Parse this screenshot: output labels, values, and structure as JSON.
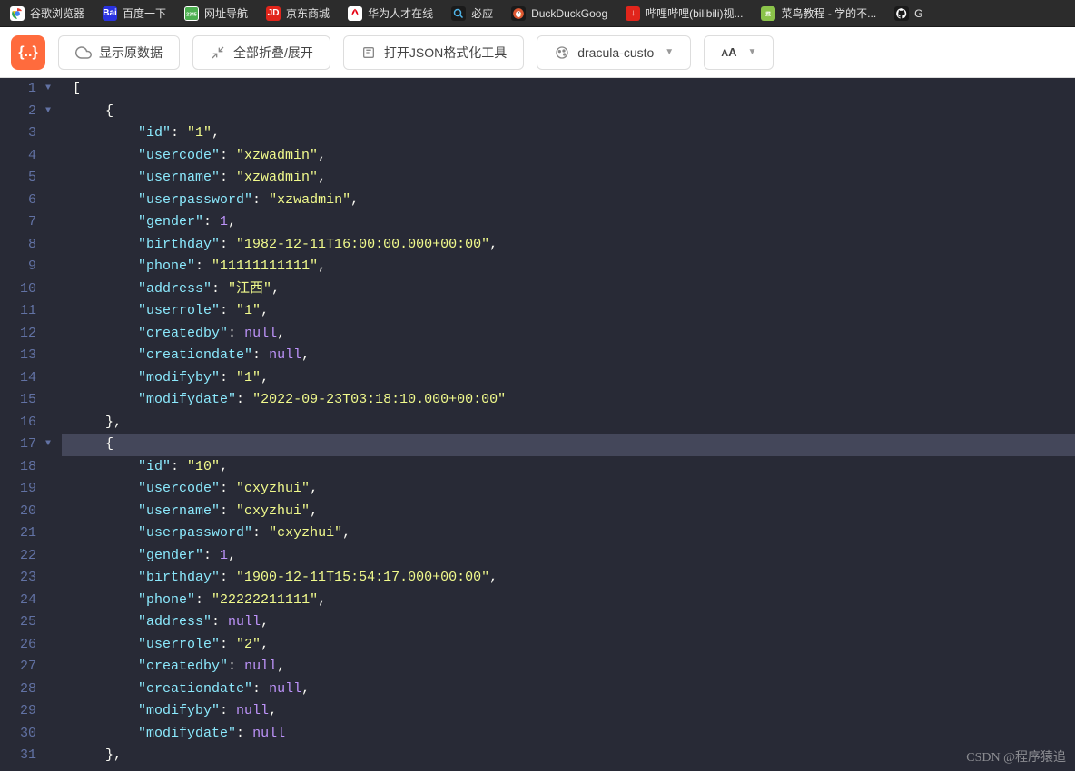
{
  "bookmarks": [
    {
      "icon_bg": "#fff",
      "icon_text": "",
      "label": "谷歌浏览器",
      "icon_svg": "chrome"
    },
    {
      "icon_bg": "#2932e1",
      "icon_text": "Bai",
      "label": "百度一下"
    },
    {
      "icon_bg": "#fff",
      "icon_text": "",
      "label": "网址导航",
      "icon_svg": "hao"
    },
    {
      "icon_bg": "#e1251b",
      "icon_text": "JD",
      "label": "京东商城"
    },
    {
      "icon_bg": "#fff",
      "icon_text": "",
      "label": "华为人才在线",
      "icon_svg": "huawei"
    },
    {
      "icon_bg": "#1a1a1a",
      "icon_text": "",
      "label": "必应",
      "icon_svg": "search"
    },
    {
      "icon_bg": "#1a1a1a",
      "icon_text": "",
      "label": "DuckDuckGoog",
      "icon_svg": "duck"
    },
    {
      "icon_bg": "#e1251b",
      "icon_text": "↓",
      "label": "哔哩哔哩(bilibili)视..."
    },
    {
      "icon_bg": "#8bc34a",
      "icon_text": "",
      "label": "菜鸟教程 - 学的不...",
      "icon_svg": "runoob"
    },
    {
      "icon_bg": "#1a1a1a",
      "icon_text": "",
      "label": "G",
      "icon_svg": "github"
    }
  ],
  "toolbar": {
    "show_raw": "显示原数据",
    "collapse_expand": "全部折叠/展开",
    "open_formatter": "打开JSON格式化工具",
    "theme": "dracula-custo",
    "font_btn": "A"
  },
  "json_lines": [
    {
      "n": 1,
      "fold": "▼",
      "indent": 0,
      "tokens": [
        {
          "t": "bracket",
          "v": "["
        }
      ]
    },
    {
      "n": 2,
      "fold": "▼",
      "indent": 1,
      "tokens": [
        {
          "t": "bracket",
          "v": "{"
        }
      ]
    },
    {
      "n": 3,
      "indent": 2,
      "tokens": [
        {
          "t": "key",
          "v": "\"id\""
        },
        {
          "t": "punct",
          "v": ": "
        },
        {
          "t": "string",
          "v": "\"1\""
        },
        {
          "t": "punct",
          "v": ","
        }
      ]
    },
    {
      "n": 4,
      "indent": 2,
      "tokens": [
        {
          "t": "key",
          "v": "\"usercode\""
        },
        {
          "t": "punct",
          "v": ": "
        },
        {
          "t": "string",
          "v": "\"xzwadmin\""
        },
        {
          "t": "punct",
          "v": ","
        }
      ]
    },
    {
      "n": 5,
      "indent": 2,
      "tokens": [
        {
          "t": "key",
          "v": "\"username\""
        },
        {
          "t": "punct",
          "v": ": "
        },
        {
          "t": "string",
          "v": "\"xzwadmin\""
        },
        {
          "t": "punct",
          "v": ","
        }
      ]
    },
    {
      "n": 6,
      "indent": 2,
      "tokens": [
        {
          "t": "key",
          "v": "\"userpassword\""
        },
        {
          "t": "punct",
          "v": ": "
        },
        {
          "t": "string",
          "v": "\"xzwadmin\""
        },
        {
          "t": "punct",
          "v": ","
        }
      ]
    },
    {
      "n": 7,
      "indent": 2,
      "tokens": [
        {
          "t": "key",
          "v": "\"gender\""
        },
        {
          "t": "punct",
          "v": ": "
        },
        {
          "t": "number",
          "v": "1"
        },
        {
          "t": "punct",
          "v": ","
        }
      ]
    },
    {
      "n": 8,
      "indent": 2,
      "tokens": [
        {
          "t": "key",
          "v": "\"birthday\""
        },
        {
          "t": "punct",
          "v": ": "
        },
        {
          "t": "string",
          "v": "\"1982-12-11T16:00:00.000+00:00\""
        },
        {
          "t": "punct",
          "v": ","
        }
      ]
    },
    {
      "n": 9,
      "indent": 2,
      "tokens": [
        {
          "t": "key",
          "v": "\"phone\""
        },
        {
          "t": "punct",
          "v": ": "
        },
        {
          "t": "string",
          "v": "\"11111111111\""
        },
        {
          "t": "punct",
          "v": ","
        }
      ]
    },
    {
      "n": 10,
      "indent": 2,
      "tokens": [
        {
          "t": "key",
          "v": "\"address\""
        },
        {
          "t": "punct",
          "v": ": "
        },
        {
          "t": "string",
          "v": "\"江西\""
        },
        {
          "t": "punct",
          "v": ","
        }
      ]
    },
    {
      "n": 11,
      "indent": 2,
      "tokens": [
        {
          "t": "key",
          "v": "\"userrole\""
        },
        {
          "t": "punct",
          "v": ": "
        },
        {
          "t": "string",
          "v": "\"1\""
        },
        {
          "t": "punct",
          "v": ","
        }
      ]
    },
    {
      "n": 12,
      "indent": 2,
      "tokens": [
        {
          "t": "key",
          "v": "\"createdby\""
        },
        {
          "t": "punct",
          "v": ": "
        },
        {
          "t": "null",
          "v": "null"
        },
        {
          "t": "punct",
          "v": ","
        }
      ]
    },
    {
      "n": 13,
      "indent": 2,
      "tokens": [
        {
          "t": "key",
          "v": "\"creationdate\""
        },
        {
          "t": "punct",
          "v": ": "
        },
        {
          "t": "null",
          "v": "null"
        },
        {
          "t": "punct",
          "v": ","
        }
      ]
    },
    {
      "n": 14,
      "indent": 2,
      "tokens": [
        {
          "t": "key",
          "v": "\"modifyby\""
        },
        {
          "t": "punct",
          "v": ": "
        },
        {
          "t": "string",
          "v": "\"1\""
        },
        {
          "t": "punct",
          "v": ","
        }
      ]
    },
    {
      "n": 15,
      "indent": 2,
      "tokens": [
        {
          "t": "key",
          "v": "\"modifydate\""
        },
        {
          "t": "punct",
          "v": ": "
        },
        {
          "t": "string",
          "v": "\"2022-09-23T03:18:10.000+00:00\""
        }
      ]
    },
    {
      "n": 16,
      "indent": 1,
      "tokens": [
        {
          "t": "bracket",
          "v": "},"
        }
      ]
    },
    {
      "n": 17,
      "fold": "▼",
      "indent": 1,
      "hl": true,
      "tokens": [
        {
          "t": "bracket",
          "v": "{"
        }
      ]
    },
    {
      "n": 18,
      "indent": 2,
      "tokens": [
        {
          "t": "key",
          "v": "\"id\""
        },
        {
          "t": "punct",
          "v": ": "
        },
        {
          "t": "string",
          "v": "\"10\""
        },
        {
          "t": "punct",
          "v": ","
        }
      ]
    },
    {
      "n": 19,
      "indent": 2,
      "tokens": [
        {
          "t": "key",
          "v": "\"usercode\""
        },
        {
          "t": "punct",
          "v": ": "
        },
        {
          "t": "string",
          "v": "\"cxyzhui\""
        },
        {
          "t": "punct",
          "v": ","
        }
      ]
    },
    {
      "n": 20,
      "indent": 2,
      "tokens": [
        {
          "t": "key",
          "v": "\"username\""
        },
        {
          "t": "punct",
          "v": ": "
        },
        {
          "t": "string",
          "v": "\"cxyzhui\""
        },
        {
          "t": "punct",
          "v": ","
        }
      ]
    },
    {
      "n": 21,
      "indent": 2,
      "tokens": [
        {
          "t": "key",
          "v": "\"userpassword\""
        },
        {
          "t": "punct",
          "v": ": "
        },
        {
          "t": "string",
          "v": "\"cxyzhui\""
        },
        {
          "t": "punct",
          "v": ","
        }
      ]
    },
    {
      "n": 22,
      "indent": 2,
      "tokens": [
        {
          "t": "key",
          "v": "\"gender\""
        },
        {
          "t": "punct",
          "v": ": "
        },
        {
          "t": "number",
          "v": "1"
        },
        {
          "t": "punct",
          "v": ","
        }
      ]
    },
    {
      "n": 23,
      "indent": 2,
      "tokens": [
        {
          "t": "key",
          "v": "\"birthday\""
        },
        {
          "t": "punct",
          "v": ": "
        },
        {
          "t": "string",
          "v": "\"1900-12-11T15:54:17.000+00:00\""
        },
        {
          "t": "punct",
          "v": ","
        }
      ]
    },
    {
      "n": 24,
      "indent": 2,
      "tokens": [
        {
          "t": "key",
          "v": "\"phone\""
        },
        {
          "t": "punct",
          "v": ": "
        },
        {
          "t": "string",
          "v": "\"22222211111\""
        },
        {
          "t": "punct",
          "v": ","
        }
      ]
    },
    {
      "n": 25,
      "indent": 2,
      "tokens": [
        {
          "t": "key",
          "v": "\"address\""
        },
        {
          "t": "punct",
          "v": ": "
        },
        {
          "t": "null",
          "v": "null"
        },
        {
          "t": "punct",
          "v": ","
        }
      ]
    },
    {
      "n": 26,
      "indent": 2,
      "tokens": [
        {
          "t": "key",
          "v": "\"userrole\""
        },
        {
          "t": "punct",
          "v": ": "
        },
        {
          "t": "string",
          "v": "\"2\""
        },
        {
          "t": "punct",
          "v": ","
        }
      ]
    },
    {
      "n": 27,
      "indent": 2,
      "tokens": [
        {
          "t": "key",
          "v": "\"createdby\""
        },
        {
          "t": "punct",
          "v": ": "
        },
        {
          "t": "null",
          "v": "null"
        },
        {
          "t": "punct",
          "v": ","
        }
      ]
    },
    {
      "n": 28,
      "indent": 2,
      "tokens": [
        {
          "t": "key",
          "v": "\"creationdate\""
        },
        {
          "t": "punct",
          "v": ": "
        },
        {
          "t": "null",
          "v": "null"
        },
        {
          "t": "punct",
          "v": ","
        }
      ]
    },
    {
      "n": 29,
      "indent": 2,
      "tokens": [
        {
          "t": "key",
          "v": "\"modifyby\""
        },
        {
          "t": "punct",
          "v": ": "
        },
        {
          "t": "null",
          "v": "null"
        },
        {
          "t": "punct",
          "v": ","
        }
      ]
    },
    {
      "n": 30,
      "indent": 2,
      "tokens": [
        {
          "t": "key",
          "v": "\"modifydate\""
        },
        {
          "t": "punct",
          "v": ": "
        },
        {
          "t": "null",
          "v": "null"
        }
      ]
    },
    {
      "n": 31,
      "indent": 1,
      "tokens": [
        {
          "t": "bracket",
          "v": "},"
        }
      ]
    }
  ],
  "watermark": "CSDN @程序猿追"
}
